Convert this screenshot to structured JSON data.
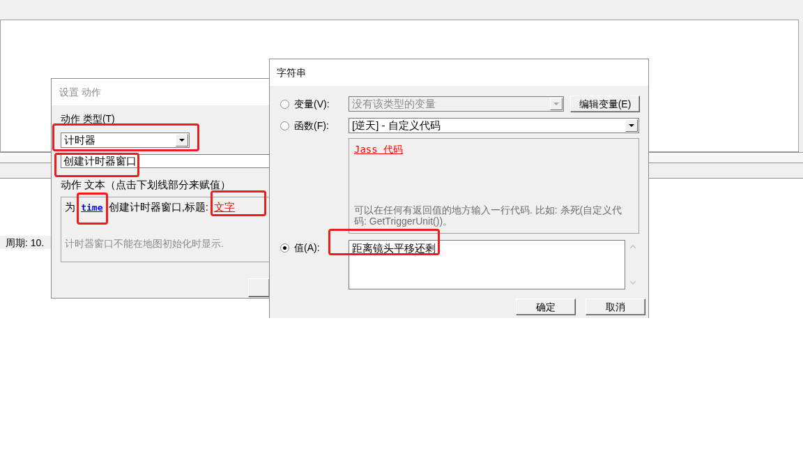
{
  "background": {
    "period_label": "周期: 10."
  },
  "action_dialog": {
    "title": "设置 动作",
    "type_label": "动作 类型(T)",
    "type_dropdown": {
      "value": "计时器"
    },
    "action_field": {
      "value": "创建计时器窗口"
    },
    "text_label": "动作 文本（点击下划线部分来赋值）",
    "action_text": [
      {
        "kind": "text",
        "text": "为"
      },
      {
        "kind": "link",
        "text": "time",
        "color": "#0000ff"
      },
      {
        "kind": "text",
        "text": "创建计时器窗口,标题:"
      },
      {
        "kind": "link",
        "text": "文字",
        "color": "#ff0000"
      }
    ],
    "note": "计时器窗口不能在地图初始化时显示."
  },
  "string_dialog": {
    "title": "字符串",
    "options": [
      {
        "kind": "variable",
        "label": "变量(V):",
        "selected": false,
        "dropdown": {
          "value": "没有该类型的变量",
          "disabled": true
        },
        "button": "编辑变量(E)"
      },
      {
        "kind": "function",
        "label": "函数(F):",
        "selected": false,
        "dropdown": {
          "value": "[逆天] - 自定义代码",
          "disabled": false
        },
        "description": {
          "link": "Jass 代码",
          "text": "可以在任何有返回值的地方输入一行代码. 比如: 杀死(自定义代码: GetTriggerUnit())。"
        }
      },
      {
        "kind": "value",
        "label": "值(A):",
        "selected": true,
        "value": "距离镜头平移还剩"
      }
    ],
    "buttons": [
      "确定",
      "取消"
    ]
  }
}
